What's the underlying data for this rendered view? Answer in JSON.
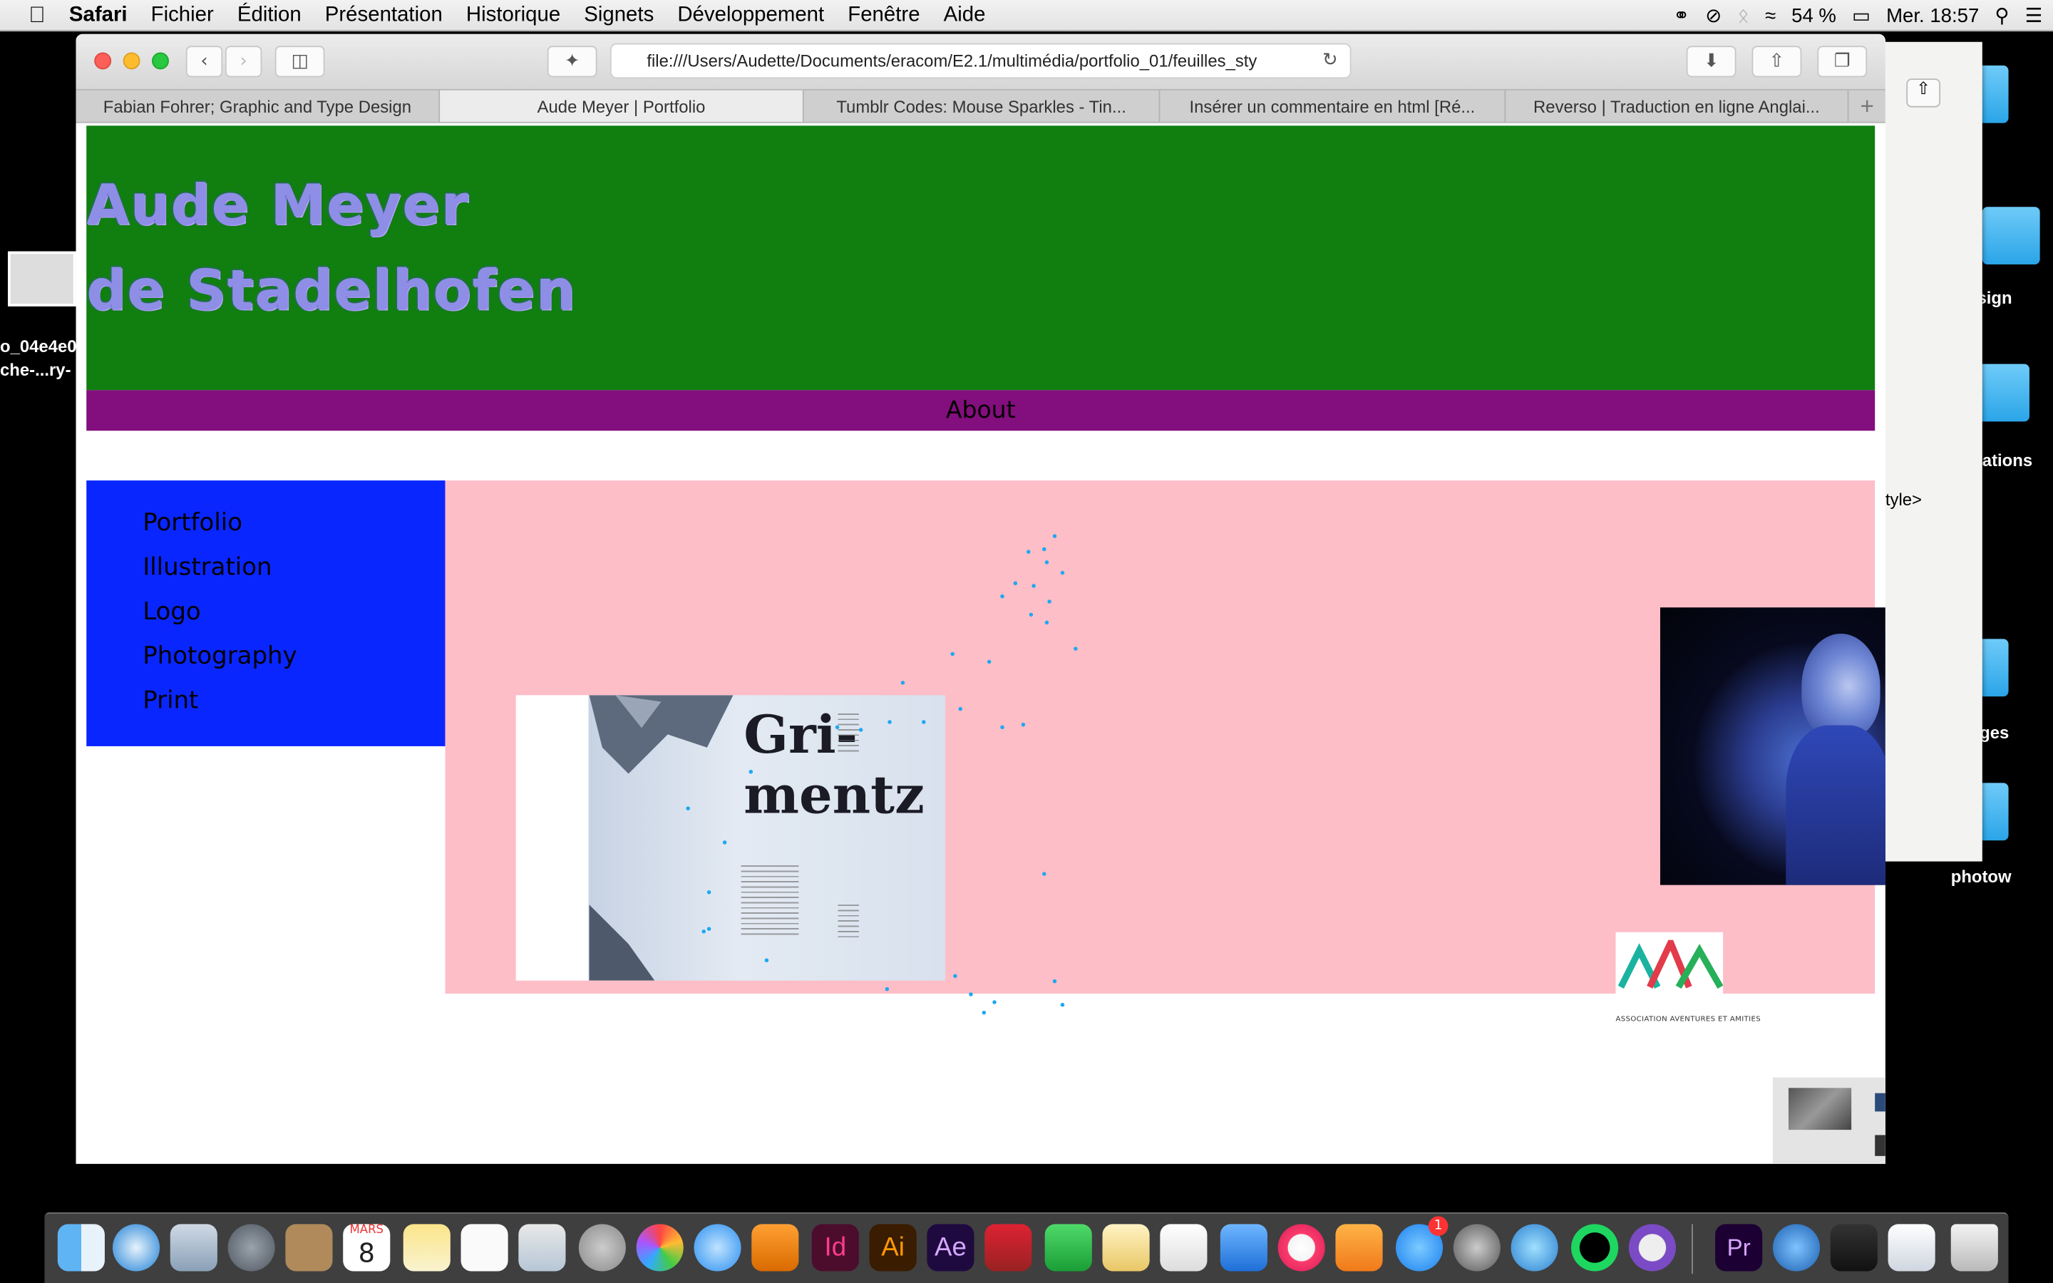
{
  "menubar": {
    "app": "Safari",
    "menus": [
      "Fichier",
      "Édition",
      "Présentation",
      "Historique",
      "Signets",
      "Développement",
      "Fenêtre",
      "Aide"
    ],
    "battery": "54 %",
    "clock": "Mer. 18:57"
  },
  "browser": {
    "url": "file:///Users/Audette/Documents/eracom/E2.1/multimédia/portfolio_01/feuilles_sty",
    "tabs": [
      "Fabian Fohrer; Graphic and Type Design",
      "Aude Meyer | Portfolio",
      "Tumblr Codes: Mouse Sparkles - Tin...",
      "Insérer un commentaire en html [Ré...",
      "Reverso | Traduction en ligne Anglai..."
    ],
    "active_tab": 1
  },
  "page": {
    "title_line1": "Aude Meyer",
    "title_line2": "de Stadelhofen",
    "nav_about": "About",
    "sidebar": [
      "Portfolio",
      "Illustration",
      "Logo",
      "Photography",
      "Print"
    ],
    "grimentz_title1": "Gri-",
    "grimentz_title2": "mentz",
    "logo_letters": "AAA",
    "logo_caption": "ASSOCIATION AVENTURES ET AMITIES"
  },
  "desktop": {
    "left_label1": "o_04e4e0",
    "left_label2": "che-...ry-",
    "right_labels": [
      "sign",
      "ations",
      "ges",
      "photow"
    ],
    "code_fragment": "tyle>"
  },
  "dock": {
    "calendar_month": "MARS",
    "calendar_day": "8",
    "badge_count": "1"
  },
  "colors": {
    "header": "#107f10",
    "nav": "#830e7d",
    "sidebar": "#0a26ff",
    "content": "#fdbec8",
    "sparkle": "#1ea8f0"
  }
}
